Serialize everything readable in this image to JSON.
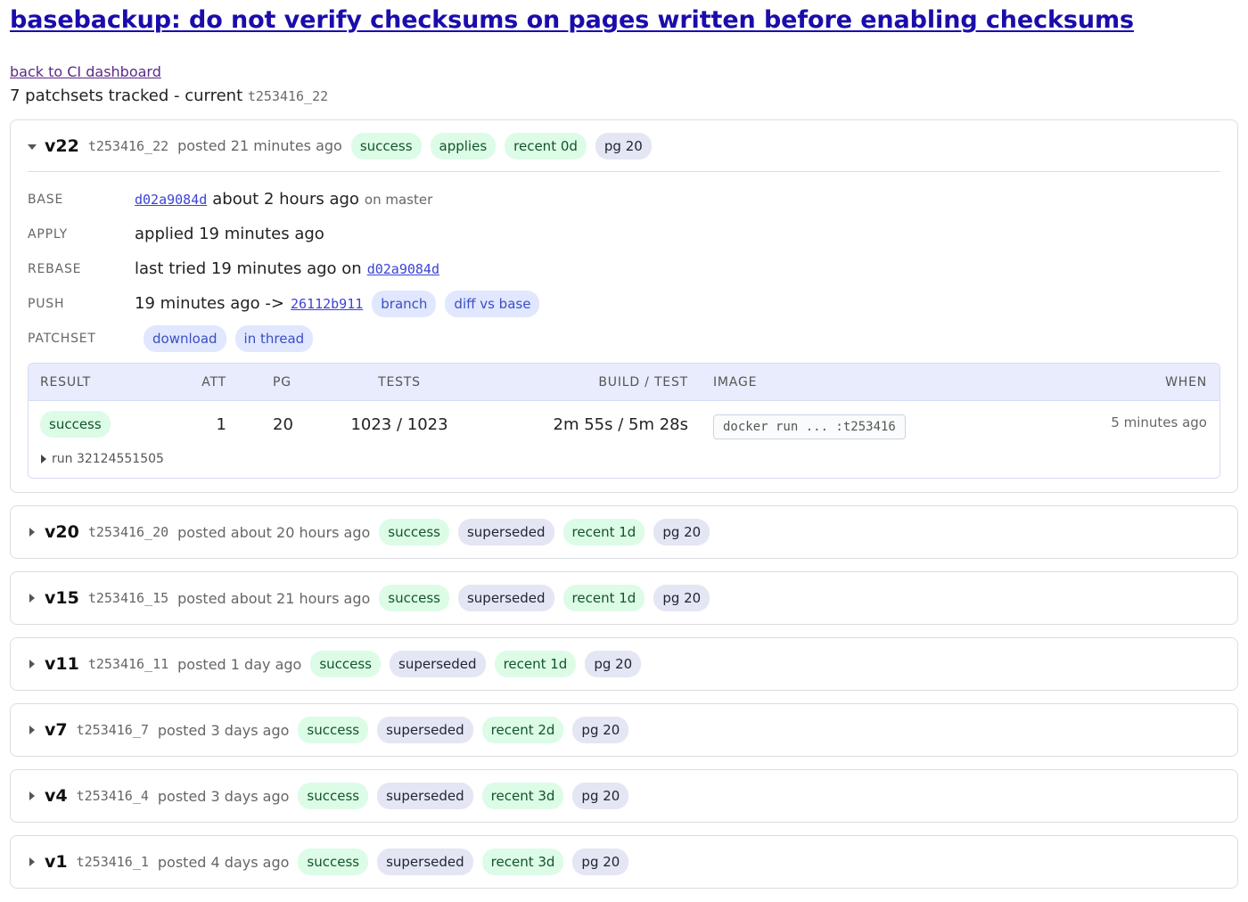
{
  "page": {
    "title": "basebackup: do not verify checksums on pages written before enabling checksums",
    "back_link": "back to CI dashboard",
    "summary_text": "7 patchsets tracked - current",
    "current_tag": "t253416_22"
  },
  "current": {
    "version": "v22",
    "tag": "t253416_22",
    "posted": "posted 21 minutes ago",
    "badges": [
      "success",
      "applies",
      "recent 0d",
      "pg 20"
    ],
    "details": {
      "base_label": "BASE",
      "base_commit": "d02a9084d",
      "base_time": "about 2 hours ago",
      "base_branch": "on master",
      "apply_label": "APPLY",
      "apply_text": "applied 19 minutes ago",
      "rebase_label": "REBASE",
      "rebase_text": "last tried 19 minutes ago on",
      "rebase_commit": "d02a9084d",
      "push_label": "PUSH",
      "push_text": "19 minutes ago ->",
      "push_commit": "26112b911",
      "push_branch": "branch",
      "push_diff": "diff vs base",
      "patchset_label": "PATCHSET",
      "patchset_download": "download",
      "patchset_thread": "in thread"
    },
    "results_table": {
      "headers": {
        "result": "RESULT",
        "att": "ATT",
        "pg": "PG",
        "tests": "TESTS",
        "build": "BUILD / TEST",
        "image": "IMAGE",
        "when": "WHEN"
      },
      "row": {
        "result": "success",
        "att": "1",
        "pg": "20",
        "tests": "1023 / 1023",
        "build": "2m 55s / 5m 28s",
        "image": "docker run ... :t253416",
        "when": "5 minutes ago"
      },
      "run_label": "run 32124551505"
    }
  },
  "history": [
    {
      "version": "v20",
      "tag": "t253416_20",
      "posted": "posted about 20 hours ago",
      "badges": [
        "success",
        "superseded",
        "recent 1d",
        "pg 20"
      ]
    },
    {
      "version": "v15",
      "tag": "t253416_15",
      "posted": "posted about 21 hours ago",
      "badges": [
        "success",
        "superseded",
        "recent 1d",
        "pg 20"
      ]
    },
    {
      "version": "v11",
      "tag": "t253416_11",
      "posted": "posted 1 day ago",
      "badges": [
        "success",
        "superseded",
        "recent 1d",
        "pg 20"
      ]
    },
    {
      "version": "v7",
      "tag": "t253416_7",
      "posted": "posted 3 days ago",
      "badges": [
        "success",
        "superseded",
        "recent 2d",
        "pg 20"
      ]
    },
    {
      "version": "v4",
      "tag": "t253416_4",
      "posted": "posted 3 days ago",
      "badges": [
        "success",
        "superseded",
        "recent 3d",
        "pg 20"
      ]
    },
    {
      "version": "v1",
      "tag": "t253416_1",
      "posted": "posted 4 days ago",
      "badges": [
        "success",
        "superseded",
        "recent 3d",
        "pg 20"
      ]
    }
  ],
  "colors": {
    "link": "#1a0dab",
    "success_badge_bg": "#dcfce7",
    "neutral_badge_bg": "#e4e6f4",
    "action_badge_bg": "#e0e7ff",
    "table_header_bg": "#e8ecfc"
  }
}
